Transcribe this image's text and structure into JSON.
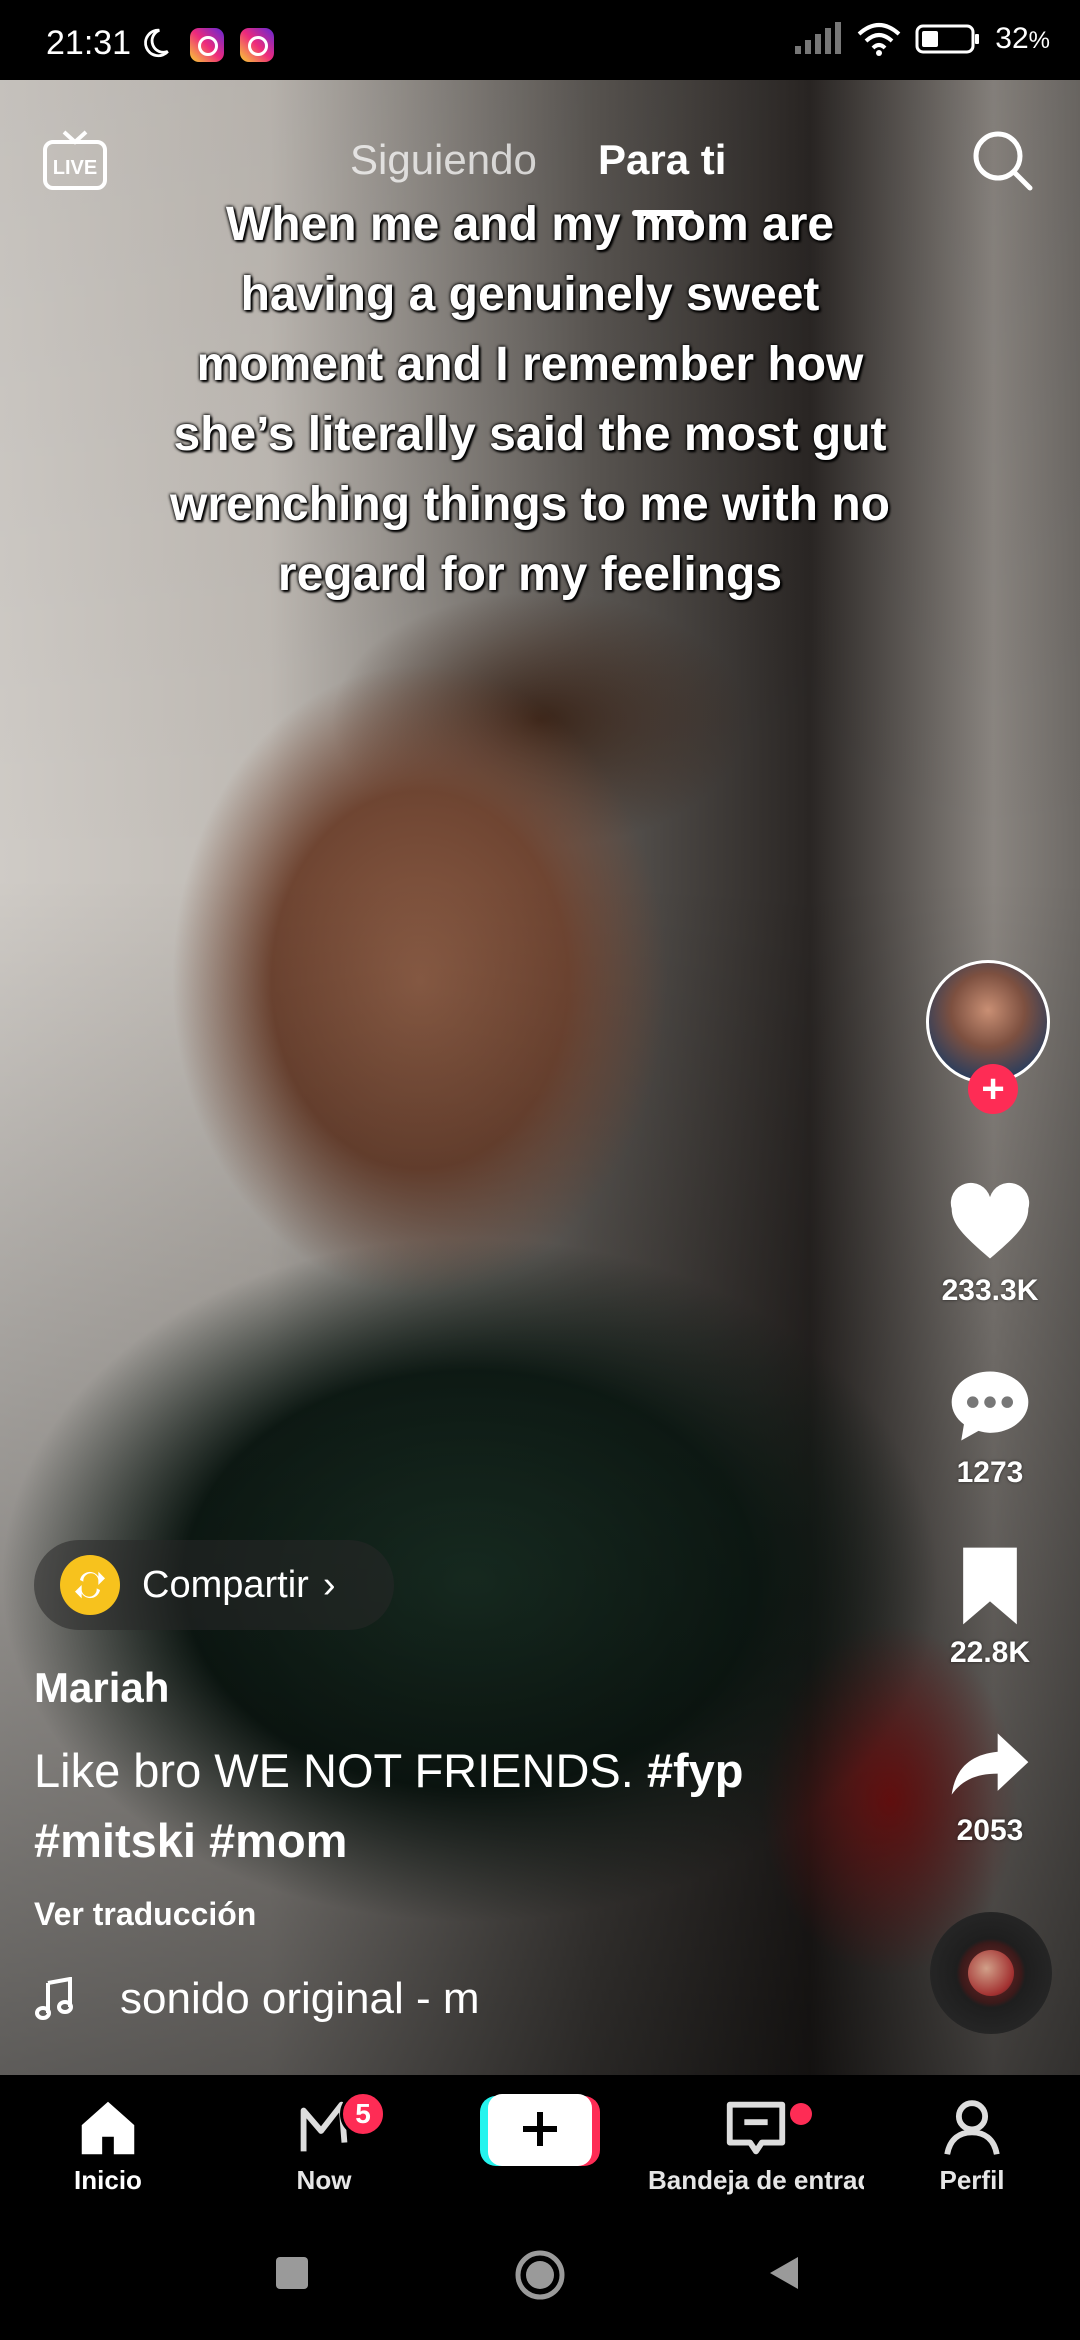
{
  "status_bar": {
    "time": "21:31",
    "battery": "32",
    "battery_unit": "%",
    "icons": [
      "moon-icon",
      "instagram-icon",
      "instagram-icon",
      "signal-icon",
      "wifi-icon",
      "battery-icon"
    ]
  },
  "top_bar": {
    "live_label": "LIVE",
    "tabs": [
      {
        "label": "Siguiendo",
        "active": false
      },
      {
        "label": "Para ti",
        "active": true
      }
    ]
  },
  "video": {
    "caption_overlay": "When me and my mom are having a genuinely sweet moment and I remember how she’s literally said the most gut wrenching things to me with no regard for my feelings"
  },
  "right_rail": {
    "likes": "233.3K",
    "comments": "1273",
    "saves": "22.8K",
    "shares": "2053"
  },
  "post": {
    "share_pill_label": "Compartir",
    "username": "Mariah",
    "description_text": "Like bro WE NOT FRIENDS. ",
    "hashtags": [
      "#fyp",
      "#mitski",
      "#mom"
    ],
    "translate_label": "Ver traducción",
    "sound_label": "sonido original - m"
  },
  "bottom_nav": {
    "items": [
      {
        "label": "Inicio",
        "icon": "home-icon"
      },
      {
        "label": "Now",
        "icon": "now-icon",
        "badge": "5"
      },
      {
        "label": "",
        "icon": "create-plus-icon"
      },
      {
        "label": "Bandeja de entrada",
        "icon": "inbox-icon"
      },
      {
        "label": "Perfil",
        "icon": "profile-icon"
      }
    ]
  },
  "colors": {
    "accent": "#fe2c55",
    "share_yellow": "#f7c21d",
    "create_cyan": "#25f4ee"
  }
}
